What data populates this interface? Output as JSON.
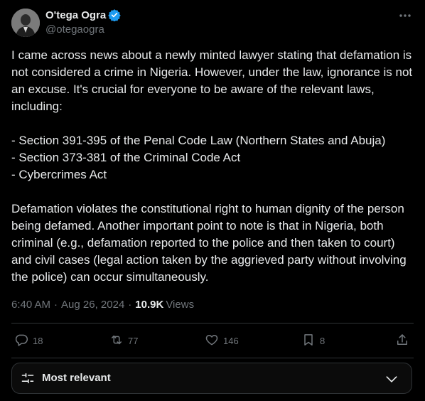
{
  "post": {
    "author": {
      "name": "O'tega Ogra",
      "handle": "@otegaogra",
      "verified": true,
      "verified_color": "#1d9bf0"
    },
    "body": {
      "intro": "I came across news about a newly minted lawyer stating that defamation is not considered a crime in Nigeria. However, under the law, ignorance is not an excuse. It's crucial for everyone to be aware of the relevant laws, including:",
      "laws": [
        "- Section 391-395 of the Penal Code Law (Northern States and Abuja)",
        "- Section 373-381 of the Criminal Code Act",
        "- Cybercrimes Act"
      ],
      "conclusion": "Defamation violates the constitutional right to human dignity of the person being defamed. Another important point to note is that in Nigeria, both criminal (e.g., defamation reported to the police and then taken to court) and civil cases (legal action taken by the aggrieved party without involving the police) can occur simultaneously."
    },
    "meta": {
      "time": "6:40 AM",
      "separator": "·",
      "date": "Aug 26, 2024",
      "views_count": "10.9K",
      "views_label": "Views"
    },
    "actions": {
      "replies": "18",
      "reposts": "77",
      "likes": "146",
      "bookmarks": "8"
    },
    "icons": {
      "more": "more-horizontal-icon",
      "reply": "reply-icon",
      "repost": "repost-icon",
      "like": "heart-icon",
      "bookmark": "bookmark-icon",
      "share": "share-icon",
      "sort": "sliders-icon",
      "chevron": "chevron-down-icon"
    }
  },
  "replies_sort": {
    "label": "Most relevant"
  },
  "colors": {
    "background": "#000000",
    "text": "#e7e9ea",
    "secondary": "#71767b",
    "border": "#2f3336"
  }
}
